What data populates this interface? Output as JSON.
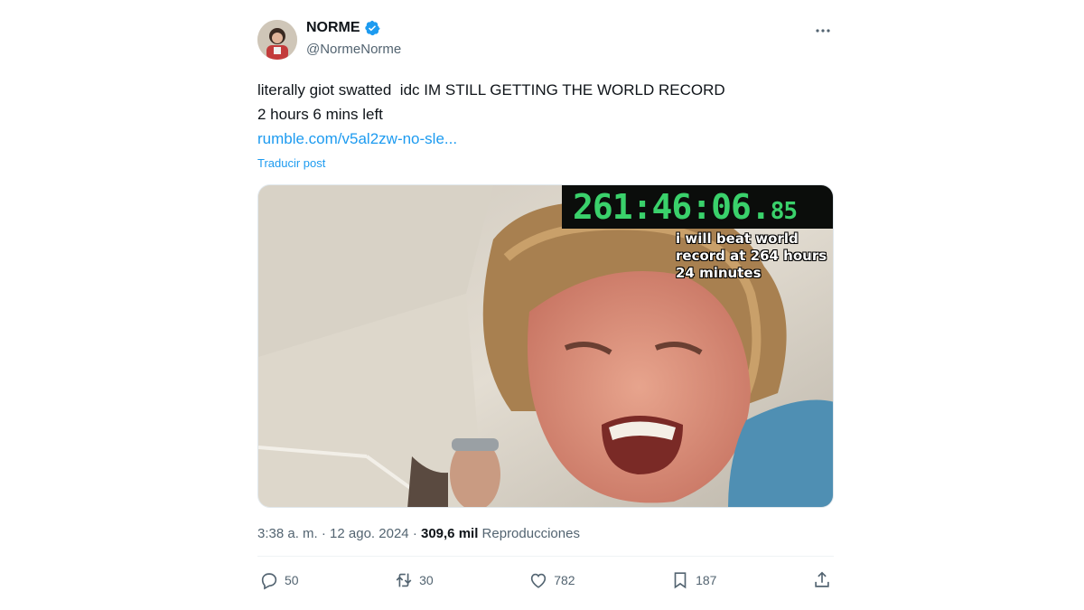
{
  "author": {
    "display_name": "NORME",
    "handle": "@NormeNorme",
    "verified_icon": "verified-badge-icon",
    "accent": "#1d9bf0"
  },
  "tweet": {
    "lines": [
      "literally giot swatted  idc IM STILL GETTING THE WORLD RECORD",
      "2 hours 6 mins left"
    ],
    "link": "rumble.com/v5al2zw-no-sle...",
    "translate_label": "Traducir post"
  },
  "media": {
    "timer_main": "261:46:06.",
    "timer_fraction": "85",
    "timer_color": "#3ad16b",
    "caption_lines": [
      "i will beat world",
      "record at 264 hours",
      "24 minutes"
    ]
  },
  "meta": {
    "time": "3:38 a. m.",
    "separator": "·",
    "date": "12 ago. 2024",
    "views_count": "309,6 mil",
    "views_label": "Reproducciones"
  },
  "actions": {
    "replies": "50",
    "reposts": "30",
    "likes": "782",
    "bookmarks": "187"
  }
}
